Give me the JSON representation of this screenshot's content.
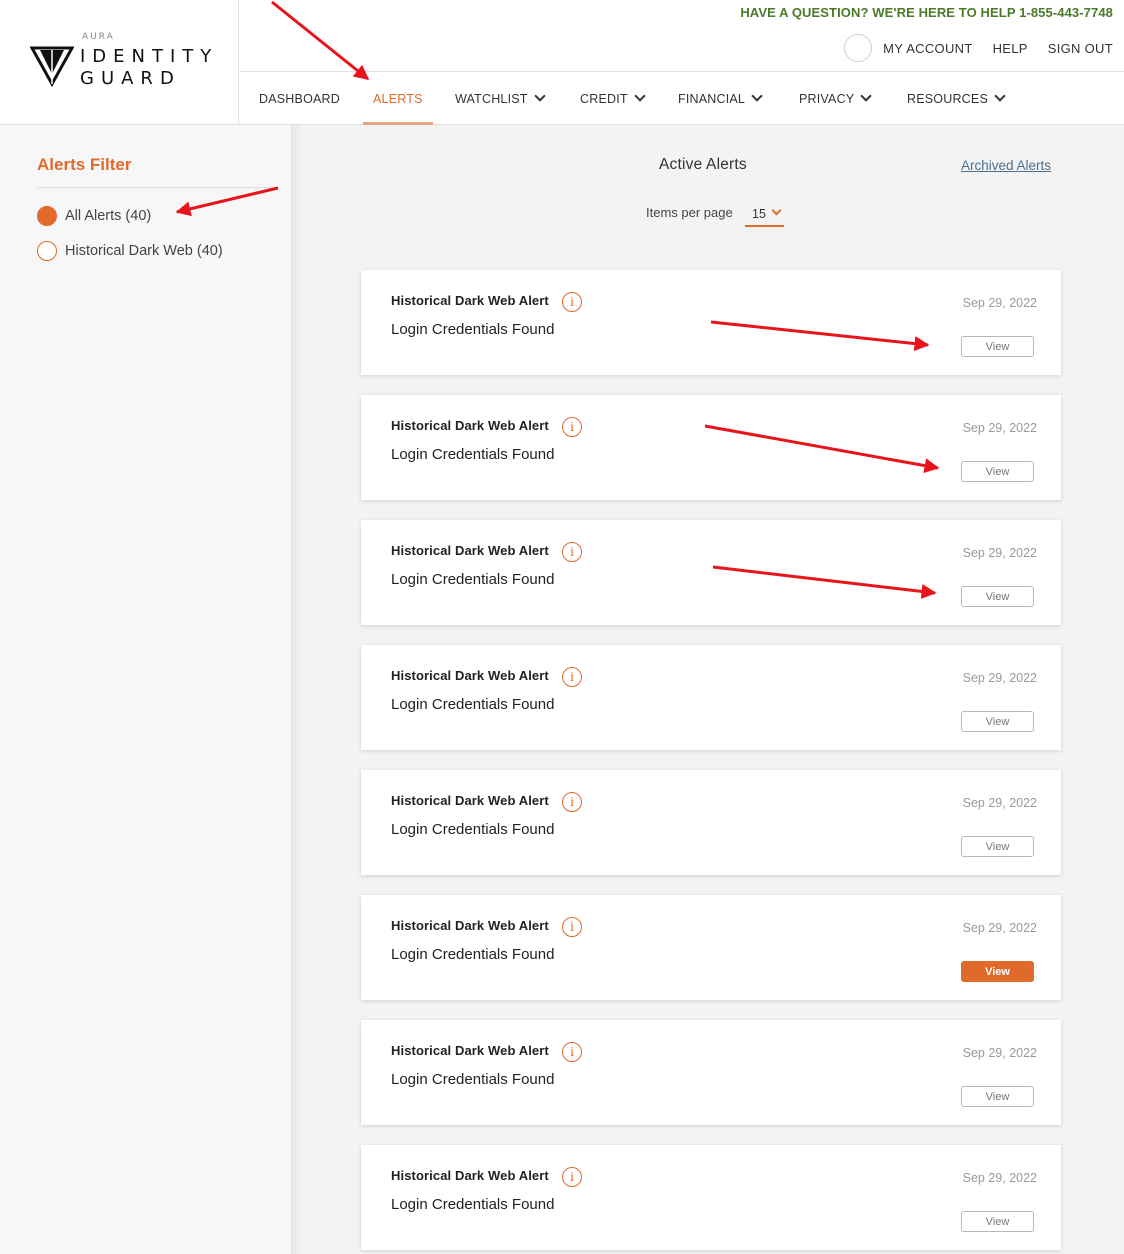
{
  "header": {
    "logo": {
      "brand": "AURA",
      "line1": "IDENTITY",
      "line2": "GUARD"
    },
    "help_text": "HAVE A QUESTION? WE'RE HERE TO HELP 1-855-443-7748",
    "links": {
      "my_account": "MY ACCOUNT",
      "help": "HELP",
      "sign_out": "SIGN OUT"
    }
  },
  "nav": {
    "items": [
      {
        "label": "DASHBOARD"
      },
      {
        "label": "ALERTS"
      },
      {
        "label": "WATCHLIST"
      },
      {
        "label": "CREDIT"
      },
      {
        "label": "FINANCIAL"
      },
      {
        "label": "PRIVACY"
      },
      {
        "label": "RESOURCES"
      }
    ],
    "active": "ALERTS"
  },
  "sidebar": {
    "title": "Alerts Filter",
    "options": [
      {
        "label": "All Alerts (40)",
        "selected": true
      },
      {
        "label": "Historical Dark Web (40)",
        "selected": false
      }
    ]
  },
  "main": {
    "title": "Active Alerts",
    "archived_link": "Archived Alerts",
    "items_per_page_label": "Items per page",
    "items_per_page_value": "15",
    "alerts": [
      {
        "title": "Historical Dark Web Alert",
        "subtitle": "Login Credentials Found",
        "date": "Sep 29, 2022",
        "button": "View",
        "highlighted": false
      },
      {
        "title": "Historical Dark Web Alert",
        "subtitle": "Login Credentials Found",
        "date": "Sep 29, 2022",
        "button": "View",
        "highlighted": false
      },
      {
        "title": "Historical Dark Web Alert",
        "subtitle": "Login Credentials Found",
        "date": "Sep 29, 2022",
        "button": "View",
        "highlighted": false
      },
      {
        "title": "Historical Dark Web Alert",
        "subtitle": "Login Credentials Found",
        "date": "Sep 29, 2022",
        "button": "View",
        "highlighted": false
      },
      {
        "title": "Historical Dark Web Alert",
        "subtitle": "Login Credentials Found",
        "date": "Sep 29, 2022",
        "button": "View",
        "highlighted": false
      },
      {
        "title": "Historical Dark Web Alert",
        "subtitle": "Login Credentials Found",
        "date": "Sep 29, 2022",
        "button": "View",
        "highlighted": true
      },
      {
        "title": "Historical Dark Web Alert",
        "subtitle": "Login Credentials Found",
        "date": "Sep 29, 2022",
        "button": "View",
        "highlighted": false
      },
      {
        "title": "Historical Dark Web Alert",
        "subtitle": "Login Credentials Found",
        "date": "Sep 29, 2022",
        "button": "View",
        "highlighted": false
      }
    ]
  },
  "colors": {
    "accent": "#e06a2c",
    "help_text": "#4a7a2a",
    "link": "#4b6f8c",
    "annotation_arrow": "#e8141b"
  },
  "icons": {
    "info": "info-circle-icon",
    "chevron": "chevron-down-icon",
    "logo": "identity-guard-logo-icon"
  }
}
